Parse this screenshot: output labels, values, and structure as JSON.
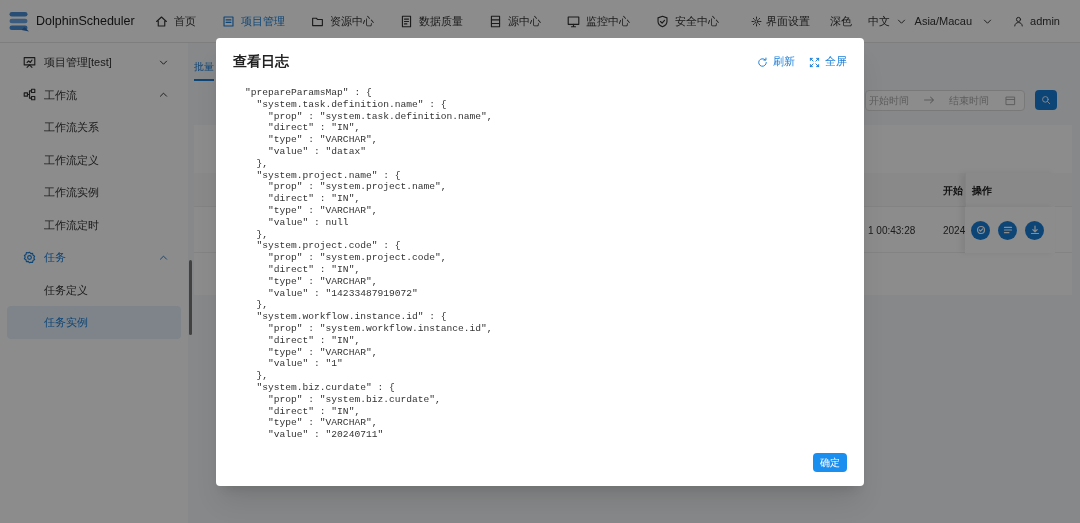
{
  "header": {
    "logo": "DolphinScheduler",
    "nav": [
      {
        "label": "首页",
        "selected": false
      },
      {
        "label": "项目管理",
        "selected": true
      },
      {
        "label": "资源中心",
        "selected": false
      },
      {
        "label": "数据质量",
        "selected": false
      },
      {
        "label": "源中心",
        "selected": false
      },
      {
        "label": "监控中心",
        "selected": false
      },
      {
        "label": "安全中心",
        "selected": false
      }
    ],
    "settings": "界面设置",
    "theme": "深色",
    "language": "中文",
    "timezone": "Asia/Macau",
    "user": "admin"
  },
  "sidebar": {
    "items": [
      {
        "label": "项目管理[test]",
        "expanded": false,
        "selected": false
      },
      {
        "label": "工作流",
        "expanded": true,
        "selected": false,
        "children": [
          {
            "label": "工作流关系",
            "selected": false
          },
          {
            "label": "工作流定义",
            "selected": false
          },
          {
            "label": "工作流实例",
            "selected": false
          },
          {
            "label": "工作流定时",
            "selected": false
          }
        ]
      },
      {
        "label": "任务",
        "expanded": true,
        "selected": true,
        "children": [
          {
            "label": "任务定义",
            "selected": false
          },
          {
            "label": "任务实例",
            "selected": true
          }
        ]
      }
    ]
  },
  "content": {
    "tab": "批量",
    "start_placeholder": "开始时间",
    "end_placeholder": "结束时间",
    "table": {
      "columns": [
        "开始",
        "操作"
      ],
      "row": {
        "cell_1": "1 00:43:28",
        "cell_2": "2024"
      }
    }
  },
  "dialog": {
    "title": "查看日志",
    "refresh": "刷新",
    "fullscreen": "全屏",
    "ok": "确定",
    "log": [
      "\"prepareParamsMap\" : {",
      "  \"system.task.definition.name\" : {",
      "    \"prop\" : \"system.task.definition.name\",",
      "    \"direct\" : \"IN\",",
      "    \"type\" : \"VARCHAR\",",
      "    \"value\" : \"datax\"",
      "  },",
      "  \"system.project.name\" : {",
      "    \"prop\" : \"system.project.name\",",
      "    \"direct\" : \"IN\",",
      "    \"type\" : \"VARCHAR\",",
      "    \"value\" : null",
      "  },",
      "  \"system.project.code\" : {",
      "    \"prop\" : \"system.project.code\",",
      "    \"direct\" : \"IN\",",
      "    \"type\" : \"VARCHAR\",",
      "    \"value\" : \"14233487919072\"",
      "  },",
      "  \"system.workflow.instance.id\" : {",
      "    \"prop\" : \"system.workflow.instance.id\",",
      "    \"direct\" : \"IN\",",
      "    \"type\" : \"VARCHAR\",",
      "    \"value\" : \"1\"",
      "  },",
      "  \"system.biz.curdate\" : {",
      "    \"prop\" : \"system.biz.curdate\",",
      "    \"direct\" : \"IN\",",
      "    \"type\" : \"VARCHAR\",",
      "    \"value\" : \"20240711\""
    ]
  }
}
